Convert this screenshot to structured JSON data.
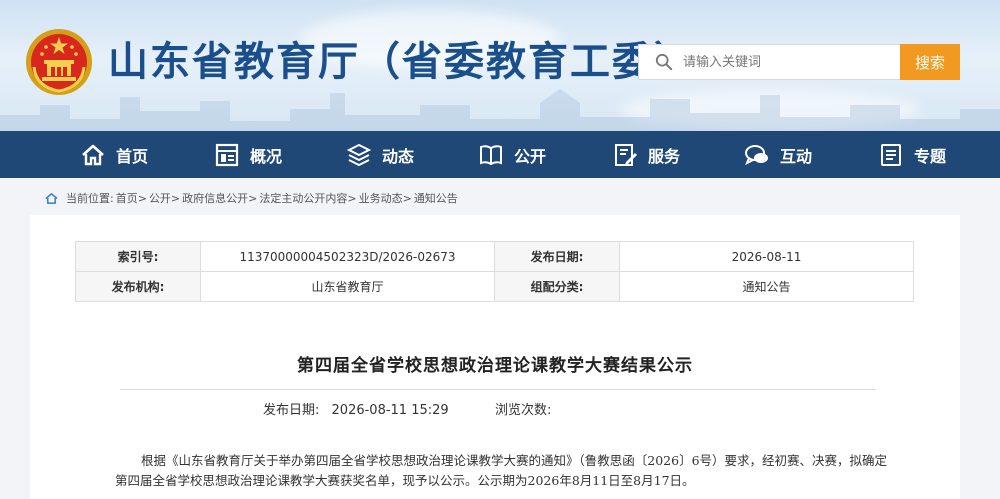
{
  "header": {
    "site_title": "山东省教育厅（省委教育工委）",
    "search_placeholder": "请输入关键词",
    "search_button": "搜索"
  },
  "nav": {
    "items": [
      {
        "label": "首页",
        "icon": "home-icon"
      },
      {
        "label": "概况",
        "icon": "overview-icon"
      },
      {
        "label": "动态",
        "icon": "news-icon"
      },
      {
        "label": "公开",
        "icon": "book-icon"
      },
      {
        "label": "服务",
        "icon": "service-icon"
      },
      {
        "label": "互动",
        "icon": "chat-icon"
      },
      {
        "label": "专题",
        "icon": "topic-icon"
      }
    ]
  },
  "breadcrumb": {
    "prefix": "当前位置:",
    "items": [
      "首页>",
      "公开>",
      "政府信息公开>",
      "法定主动公开内容>",
      "业务动态>",
      "通知公告"
    ]
  },
  "meta": {
    "index_label": "索引号:",
    "index_value": "11370000004502323D/2026-02673",
    "date_label": "发布日期:",
    "date_value": "2026-08-11",
    "org_label": "发布机构:",
    "org_value": "山东省教育厅",
    "category_label": "组配分类:",
    "category_value": "通知公告"
  },
  "article": {
    "title": "第四届全省学校思想政治理论课教学大赛结果公示",
    "publish_label": "发布日期:",
    "publish_value": "2026-08-11 15:29",
    "views_label": "浏览次数:",
    "views_value": "",
    "paragraph": "根据《山东省教育厅关于举办第四届全省学校思想政治理论课教学大赛的通知》（鲁教思函〔2026〕6号）要求，经初赛、决赛，拟确定第四届全省学校思想政治理论课教学大赛获奖名单，现予以公示。公示期为2026年8月11日至8月17日。"
  },
  "colors": {
    "nav_bg": "#1f4877",
    "title_blue": "#1b4f8c",
    "search_orange": "#f29a1f"
  }
}
